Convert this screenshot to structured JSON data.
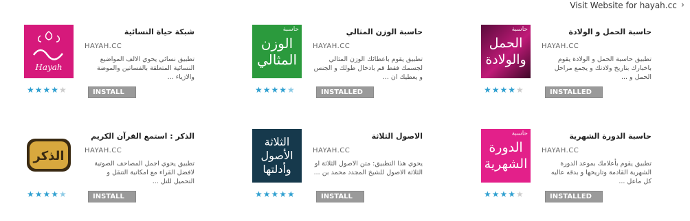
{
  "visit_link": "Visit Website for hayah.cc",
  "apps": [
    {
      "title": "شبكة حياة النسائية",
      "developer": "HAYAH.CC",
      "desc": "تطبيق نسائي يحوي الالف المواضيع النسائية المتعلقة بالفساتين والموضة والازياء ...",
      "rating": 4,
      "button": "INSTALL",
      "thumb_text": "Hayah",
      "thumb_tag": ""
    },
    {
      "title": "حاسبة الوزن المثالي",
      "developer": "HAYAH.CC",
      "desc": "تطبيق يقوم باعطائك الوزن المثالي لجسمك فقط قم بادخال طولك و الجنس و يعطيك ان ...",
      "rating": 4.5,
      "button": "INSTALLED",
      "thumb_text": "الوزن المثالي",
      "thumb_tag": "حاسبة"
    },
    {
      "title": "حاسبة الحمل و الولادة",
      "developer": "HAYAH.CC",
      "desc": "تطبيق حاسبة الحمل و الولادة يقوم باخبارك بتاريخ ولادتك و يجمع مراحل الحمل و ...",
      "rating": 4,
      "button": "INSTALLED",
      "thumb_text": "الحمل والولادة",
      "thumb_tag": "حاسبة"
    },
    {
      "title": "الذكر : استمع القرآن الكريم",
      "developer": "HAYAH.CC",
      "desc": "تطبيق يحوي اجمل المصاحف الصوتية لافضل القراء مع امكانية التنقل و التحميل للتل ...",
      "rating": 4.5,
      "button": "INSTALL",
      "thumb_text": "الذكر",
      "thumb_tag": ""
    },
    {
      "title": "الاصول الثلاثة",
      "developer": "HAYAH.CC",
      "desc": "يحوي هذا التطبيق: متن الاصول الثلاثة او الثلاثة الاصول للشيخ المجدد محمد بن ...",
      "rating": 5,
      "button": "INSTALL",
      "thumb_text": "الثلاثة الأصول وأدلتها",
      "thumb_tag": ""
    },
    {
      "title": "حاسبة الدورة الشهرية",
      "developer": "HAYAH.CC",
      "desc": "تطبيق يقوم بأعلامك بموعد الدورة الشهرية القادمة وتاريخها و بدقه عاليه كل ماعل ...",
      "rating": 4,
      "button": "INSTALLED",
      "thumb_text": "الدورة الشهرية",
      "thumb_tag": "حاسبة"
    }
  ]
}
